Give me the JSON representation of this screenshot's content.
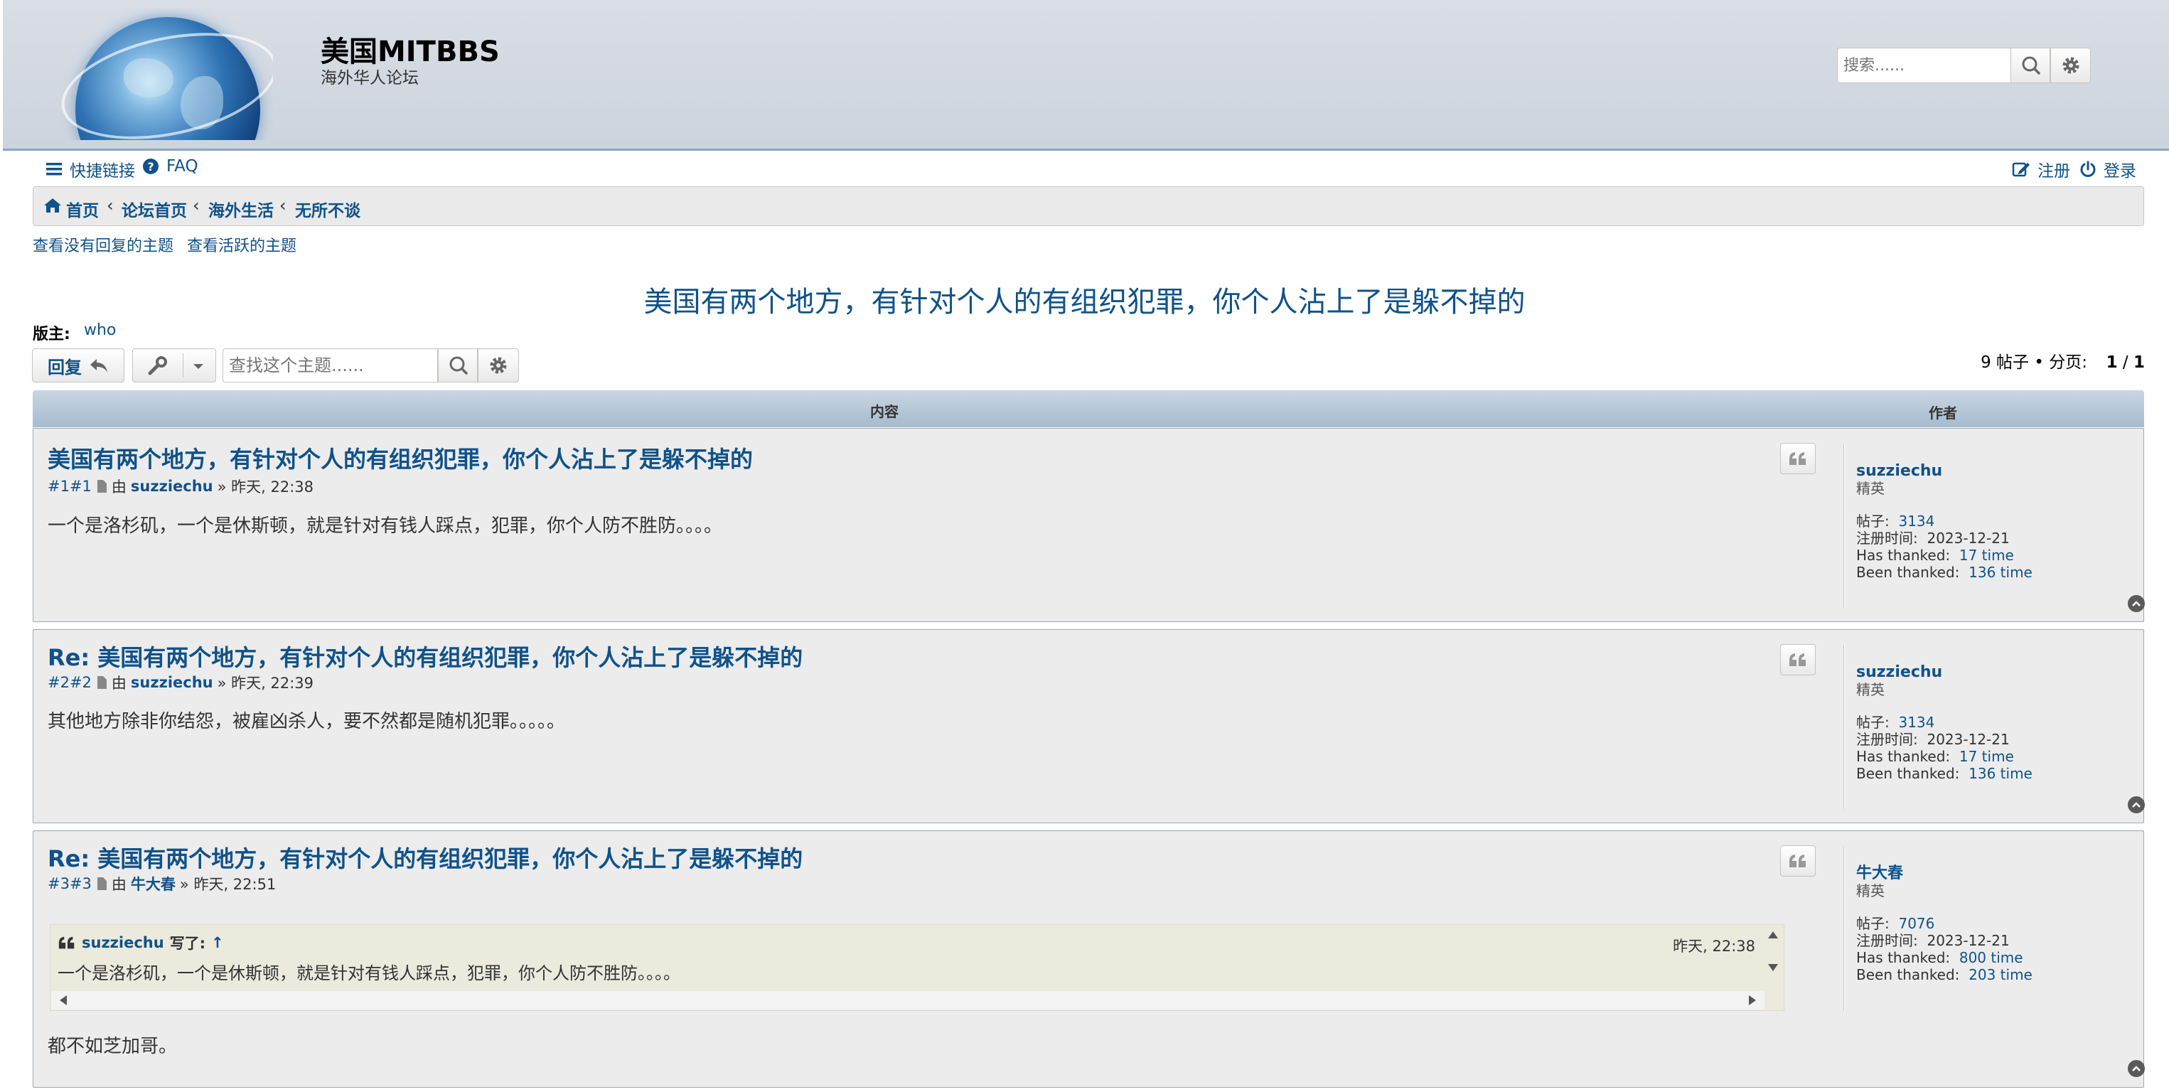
{
  "site": {
    "title": "美国MITBBS",
    "description": "海外华人论坛",
    "search_placeholder": "搜索......"
  },
  "nav": {
    "quick_links": "快捷链接",
    "faq": "FAQ",
    "register": "注册",
    "login": "登录"
  },
  "breadcrumbs": [
    "首页",
    "论坛首页",
    "海外生活",
    "无所不谈"
  ],
  "links": {
    "unanswered": "查看没有回复的主题",
    "active": "查看活跃的主题"
  },
  "topic": {
    "title": "美国有两个地方，有针对个人的有组织犯罪，你个人沾上了是躲不掉的",
    "moderator_label": "版主:",
    "moderator": "who",
    "reply_label": "回复",
    "search_placeholder": "查找这个主题......",
    "post_count": "9 帖子",
    "page_label": "分页:",
    "page_current": "1",
    "page_total": "1"
  },
  "table": {
    "content_header": "内容",
    "author_header": "作者"
  },
  "posts": [
    {
      "title": "美国有两个地方，有针对个人的有组织犯罪，你个人沾上了是躲不掉的",
      "number": "#1#1",
      "by": "由",
      "author": "suzziechu",
      "time": "» 昨天, 22:38",
      "body": "一个是洛杉矶，一个是休斯顿，就是针对有钱人踩点，犯罪，你个人防不胜防。。。。",
      "profile": {
        "name": "suzziechu",
        "rank": "精英",
        "posts_label": "帖子:",
        "posts": "3134",
        "joined_label": "注册时间:",
        "joined": "2023-12-21",
        "has_thanked_label": "Has thanked:",
        "has_thanked": "17 time",
        "been_thanked_label": "Been thanked:",
        "been_thanked": "136 time"
      }
    },
    {
      "title": "Re: 美国有两个地方，有针对个人的有组织犯罪，你个人沾上了是躲不掉的",
      "number": "#2#2",
      "by": "由",
      "author": "suzziechu",
      "time": "» 昨天, 22:39",
      "body": "其他地方除非你结怨，被雇凶杀人，要不然都是随机犯罪。。。。。",
      "profile": {
        "name": "suzziechu",
        "rank": "精英",
        "posts_label": "帖子:",
        "posts": "3134",
        "joined_label": "注册时间:",
        "joined": "2023-12-21",
        "has_thanked_label": "Has thanked:",
        "has_thanked": "17 time",
        "been_thanked_label": "Been thanked:",
        "been_thanked": "136 time"
      }
    },
    {
      "title": "Re: 美国有两个地方，有针对个人的有组织犯罪，你个人沾上了是躲不掉的",
      "number": "#3#3",
      "by": "由",
      "author": "牛大春",
      "time": "» 昨天, 22:51",
      "quote": {
        "author": "suzziechu",
        "said": "写了:",
        "up": "↑",
        "time": "昨天, 22:38",
        "text": "一个是洛杉矶，一个是休斯顿，就是针对有钱人踩点，犯罪，你个人防不胜防。。。。"
      },
      "body": "都不如芝加哥。",
      "profile": {
        "name": "牛大春",
        "rank": "精英",
        "posts_label": "帖子:",
        "posts": "7076",
        "joined_label": "注册时间:",
        "joined": "2023-12-21",
        "has_thanked_label": "Has thanked:",
        "has_thanked": "800 time",
        "been_thanked_label": "Been thanked:",
        "been_thanked": "203 time"
      }
    }
  ],
  "colors": {
    "link": "#105289",
    "header_bg": "#cdd4dd",
    "post_bg_1": "#e1ebf2",
    "post_bg_2": "#ececec",
    "quote_bg": "#ebeadd"
  }
}
